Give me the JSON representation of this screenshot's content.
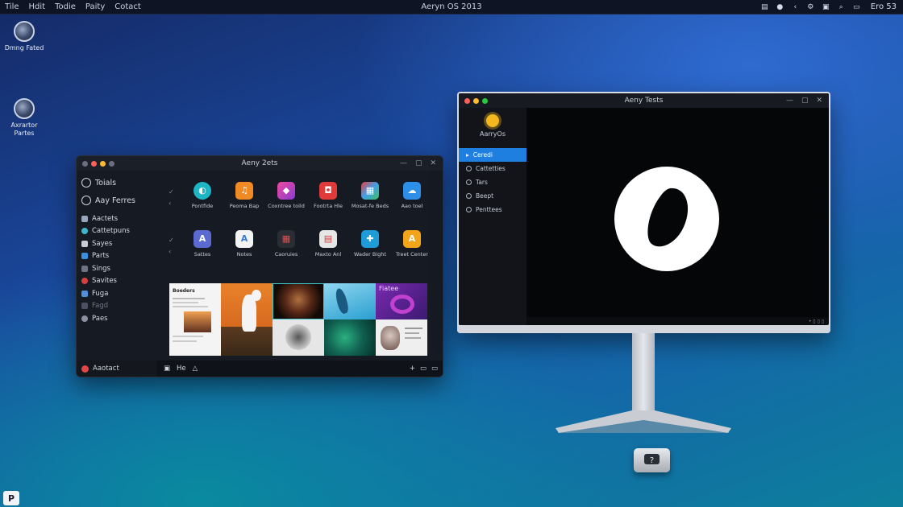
{
  "menubar": {
    "menus": [
      "Tile",
      "Hdit",
      "Todie",
      "Paity",
      "Cotact"
    ],
    "title": "Aeryn OS 2013",
    "clock": "Ero 53"
  },
  "desktop": {
    "icons": [
      {
        "label": "Dmng Fated"
      },
      {
        "label": "Axrartor Partes"
      }
    ]
  },
  "left_window": {
    "title": "Aeny 2ets",
    "sidebar": {
      "top": [
        "Toials",
        "Aay Ferres"
      ],
      "items": [
        {
          "label": "Aactets",
          "color": "#9aa6ba"
        },
        {
          "label": "Cattetpuns",
          "color": "#3fb6c9"
        },
        {
          "label": "Sayes",
          "color": "#c8ccd4"
        },
        {
          "label": "Parts",
          "color": "#3b8fe0"
        },
        {
          "label": "Sings",
          "color": "#6b7384"
        },
        {
          "label": "Savites",
          "color": "#d84040"
        },
        {
          "label": "Fuga",
          "color": "#4f8fdc"
        },
        {
          "label": "Fagd",
          "color": "#4b5160",
          "dim": true
        },
        {
          "label": "Paes",
          "color": "#8a91a0"
        }
      ]
    },
    "apps": [
      {
        "label": "Pontfide",
        "color": "#1eb6c4",
        "glyph": "◐"
      },
      {
        "label": "Peoma Bap",
        "color": "#f08a24",
        "glyph": "♫"
      },
      {
        "label": "Coxntree toild",
        "color": "#d63a9a",
        "glyph": "◆"
      },
      {
        "label": "Footrta Hle",
        "color": "#e03a3a",
        "glyph": "◘"
      },
      {
        "label": "Mosat-fe Beds",
        "color": "#e8e8ea",
        "glyph": "▦"
      },
      {
        "label": "Aao toel",
        "color": "#2e8fe8",
        "glyph": "☁"
      },
      {
        "label": "Sattes",
        "color": "#5b6ad0",
        "glyph": "A"
      },
      {
        "label": "Notes",
        "color": "#f3f3f3",
        "glyph": "A"
      },
      {
        "label": "Caoruies",
        "color": "#2a2d33",
        "glyph": "▦"
      },
      {
        "label": "Maxto Anl",
        "color": "#e6e6e6",
        "glyph": "▤"
      },
      {
        "label": "Wader Bight",
        "color": "#1f9bd8",
        "glyph": "✚"
      },
      {
        "label": "Treet Center",
        "color": "#f2a51a",
        "glyph": "A"
      }
    ],
    "thumb_caption": "Fiatee",
    "thumb_doc_title": "Boeders",
    "statusbar": {
      "account": "Aaotact",
      "mid_label": "He",
      "right_icons": [
        "+",
        "▭",
        "▭"
      ]
    }
  },
  "monitor": {
    "title": "Aeny Tests",
    "brand": "AarryOs",
    "nav": [
      {
        "label": "Ceredi",
        "active": true
      },
      {
        "label": "Cattetties"
      },
      {
        "label": "Tars"
      },
      {
        "label": "Beept"
      },
      {
        "label": "Penttees"
      }
    ],
    "status_icons": "• ▯ ▯ ▯"
  },
  "corner_button": "P",
  "colors": {
    "accent": "#1f7fe0",
    "window_bg": "#161a22",
    "desktop_top": "#152a66",
    "desktop_bottom": "#0d7f9c"
  }
}
